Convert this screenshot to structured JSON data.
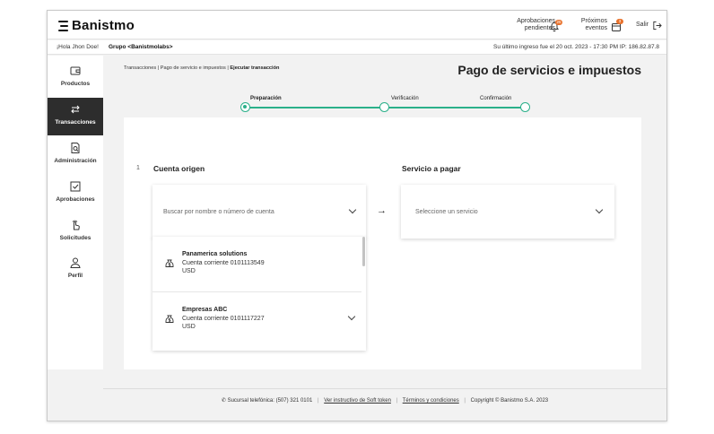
{
  "brand": {
    "name": "Banistmo",
    "accent": "#2bb08a",
    "badge_color": "#e8712c"
  },
  "topbar": {
    "approvals_label_1": "Aprobaciones",
    "approvals_label_2": "pendientes",
    "approvals_badge": "25",
    "events_label_1": "Próximos",
    "events_label_2": "eventos",
    "events_badge": "3",
    "logout_label": "Salir"
  },
  "greetbar": {
    "greeting": "¡Hola Jhon Doe!",
    "group": "Grupo <Banistmolabs>",
    "last_login": "Su último ingreso fue el 20 oct. 2023 - 17:30 PM IP: 186.82.87.8"
  },
  "sidebar": {
    "items": [
      {
        "label": "Productos",
        "icon": "wallet-icon"
      },
      {
        "label": "Transacciones",
        "icon": "transfer-arrows-icon"
      },
      {
        "label": "Administración",
        "icon": "document-search-icon"
      },
      {
        "label": "Aprobaciones",
        "icon": "checkbox-icon"
      },
      {
        "label": "Solicitudes",
        "icon": "hand-pointer-icon"
      },
      {
        "label": "Perfil",
        "icon": "user-icon"
      }
    ]
  },
  "breadcrumb": {
    "item1": "Transacciones",
    "item2": "Pago de servicio e impuestos",
    "item3": "Ejecutar transacción"
  },
  "page": {
    "title": "Pago de servicios e impuestos"
  },
  "stepper": {
    "steps": [
      "Preparación",
      "Verificación",
      "Confirmación"
    ]
  },
  "form": {
    "step_number": "1",
    "origin_heading": "Cuenta origen",
    "origin_placeholder": "Buscar por nombre o número de cuenta",
    "service_heading": "Servicio a pagar",
    "service_placeholder": "Seleccione un servicio",
    "accounts": [
      {
        "name": "Panamerica solutions",
        "detail": "Cuenta corriente 0101113549",
        "currency": "USD"
      },
      {
        "name": "Empresas ABC",
        "detail": "Cuenta corriente 0101117227",
        "currency": "USD"
      }
    ]
  },
  "footer": {
    "phone": "Sucursal telefónica: (507) 321 0101",
    "link1": "Ver instructivo de Soft token",
    "link2": "Términos y condiciones",
    "copyright": "Copyright © Banistmo S.A. 2023"
  }
}
